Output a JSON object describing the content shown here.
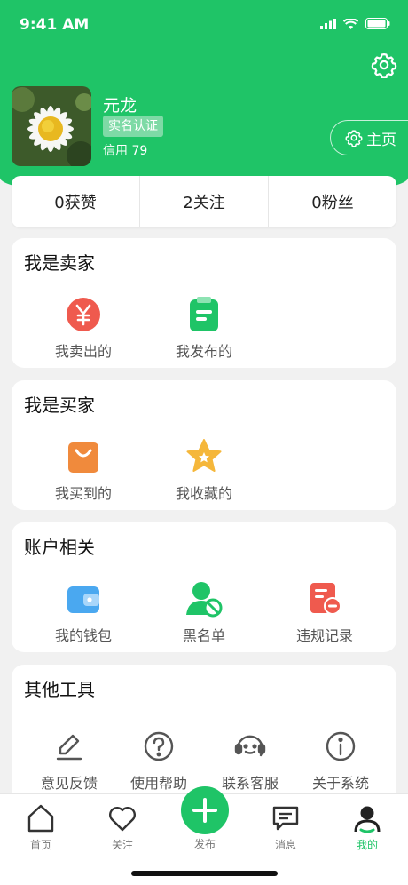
{
  "status_bar": {
    "time": "9:41 AM"
  },
  "profile": {
    "name": "元龙",
    "verify_badge": "实名认证",
    "credit": "信用 79",
    "home_button_label": "主页"
  },
  "stats": [
    {
      "label": "0获赞"
    },
    {
      "label": "2关注"
    },
    {
      "label": "0粉丝"
    }
  ],
  "seller": {
    "title": "我是卖家",
    "items": [
      {
        "label": "我卖出的",
        "icon": "yen-coin-icon",
        "color": "#ef5a4e"
      },
      {
        "label": "我发布的",
        "icon": "clipboard-icon",
        "color": "#1fc467"
      }
    ]
  },
  "buyer": {
    "title": "我是买家",
    "items": [
      {
        "label": "我买到的",
        "icon": "shopping-bag-icon",
        "color": "#f08a3c"
      },
      {
        "label": "我收藏的",
        "icon": "star-icon",
        "color": "#f5b73b"
      }
    ]
  },
  "account": {
    "title": "账户相关",
    "items": [
      {
        "label": "我的钱包",
        "icon": "wallet-icon",
        "color": "#4aa8f0"
      },
      {
        "label": "黑名单",
        "icon": "blocked-user-icon",
        "color": "#1fc467"
      },
      {
        "label": "违规记录",
        "icon": "violation-record-icon",
        "color": "#ef5a4e"
      }
    ]
  },
  "tools": {
    "title": "其他工具",
    "items": [
      {
        "label": "意见反馈",
        "icon": "edit-icon"
      },
      {
        "label": "使用帮助",
        "icon": "help-icon"
      },
      {
        "label": "联系客服",
        "icon": "customer-service-icon"
      },
      {
        "label": "关于系统",
        "icon": "info-icon"
      }
    ]
  },
  "tabbar": {
    "home": "首页",
    "follow": "关注",
    "publish": "发布",
    "messages": "消息",
    "mine": "我的"
  },
  "colors": {
    "brand": "#1fc467",
    "background": "#f1f1f1"
  }
}
